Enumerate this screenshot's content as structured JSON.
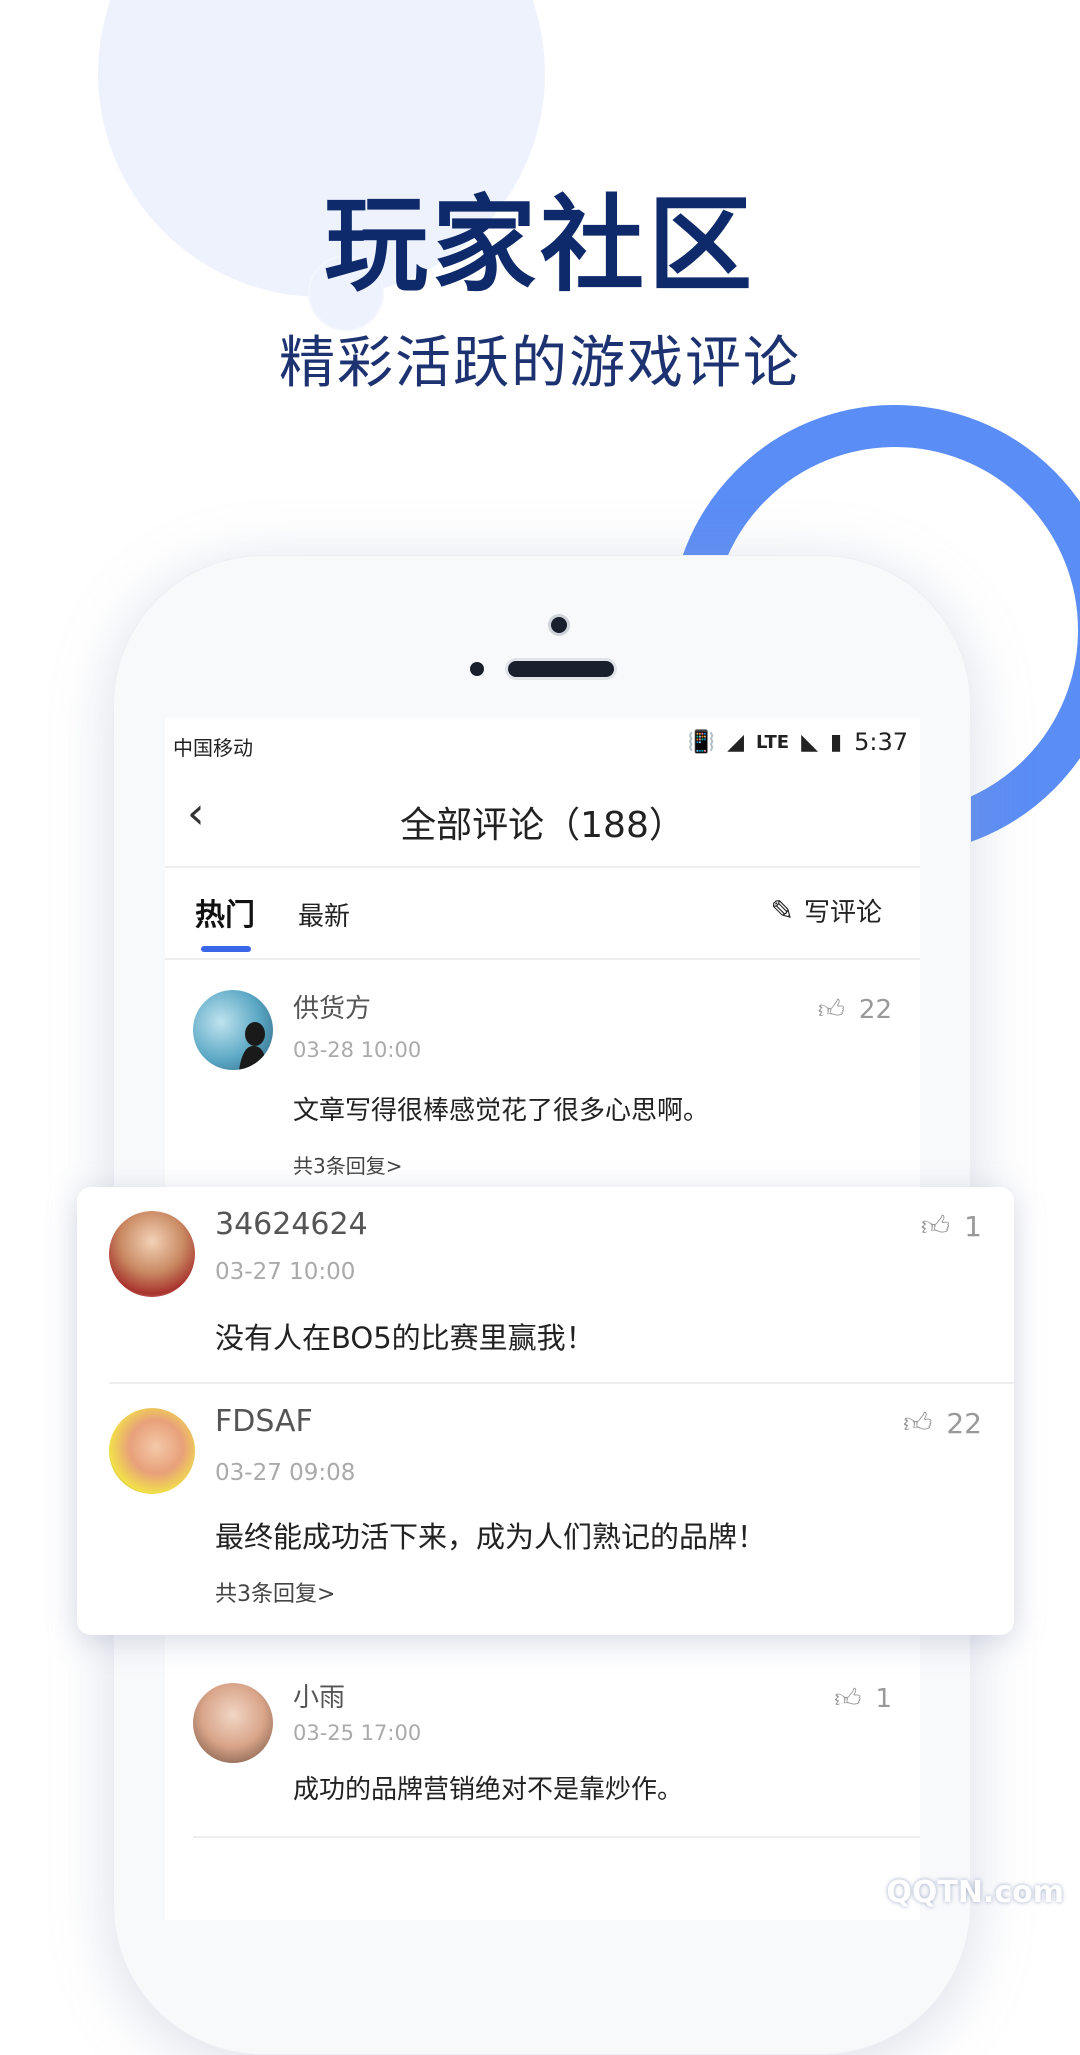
{
  "hero": {
    "title": "玩家社区",
    "subtitle": "精彩活跃的游戏评论"
  },
  "status_bar": {
    "carrier": "中国移动",
    "network": "LTE",
    "time": "5:37"
  },
  "nav": {
    "back_icon": "chevron-left-icon",
    "title": "全部评论（188）"
  },
  "tabs": {
    "hot": "热门",
    "latest": "最新",
    "write": "写评论"
  },
  "comments": [
    {
      "name": "供货方",
      "time": "03-28 10:00",
      "likes": "22",
      "text": "文章写得很棒感觉花了很多心思啊。",
      "replies": "共3条回复>"
    },
    {
      "name": "34624624",
      "time": "03-27 10:00",
      "likes": "1",
      "text": "没有人在BO5的比赛里赢我！"
    },
    {
      "name": "FDSAF",
      "time": "03-27 09:08",
      "likes": "22",
      "text": "最终能成功活下来，成为人们熟记的品牌！",
      "replies": "共3条回复>"
    },
    {
      "name": "小雨",
      "time": "03-25 17:00",
      "likes": "1",
      "text": "成功的品牌营销绝对不是靠炒作。"
    }
  ],
  "colors": {
    "accent": "#3a66e8",
    "ring": "#5b8df6",
    "title": "#0f2a6b"
  },
  "watermark": "QQTN.com"
}
